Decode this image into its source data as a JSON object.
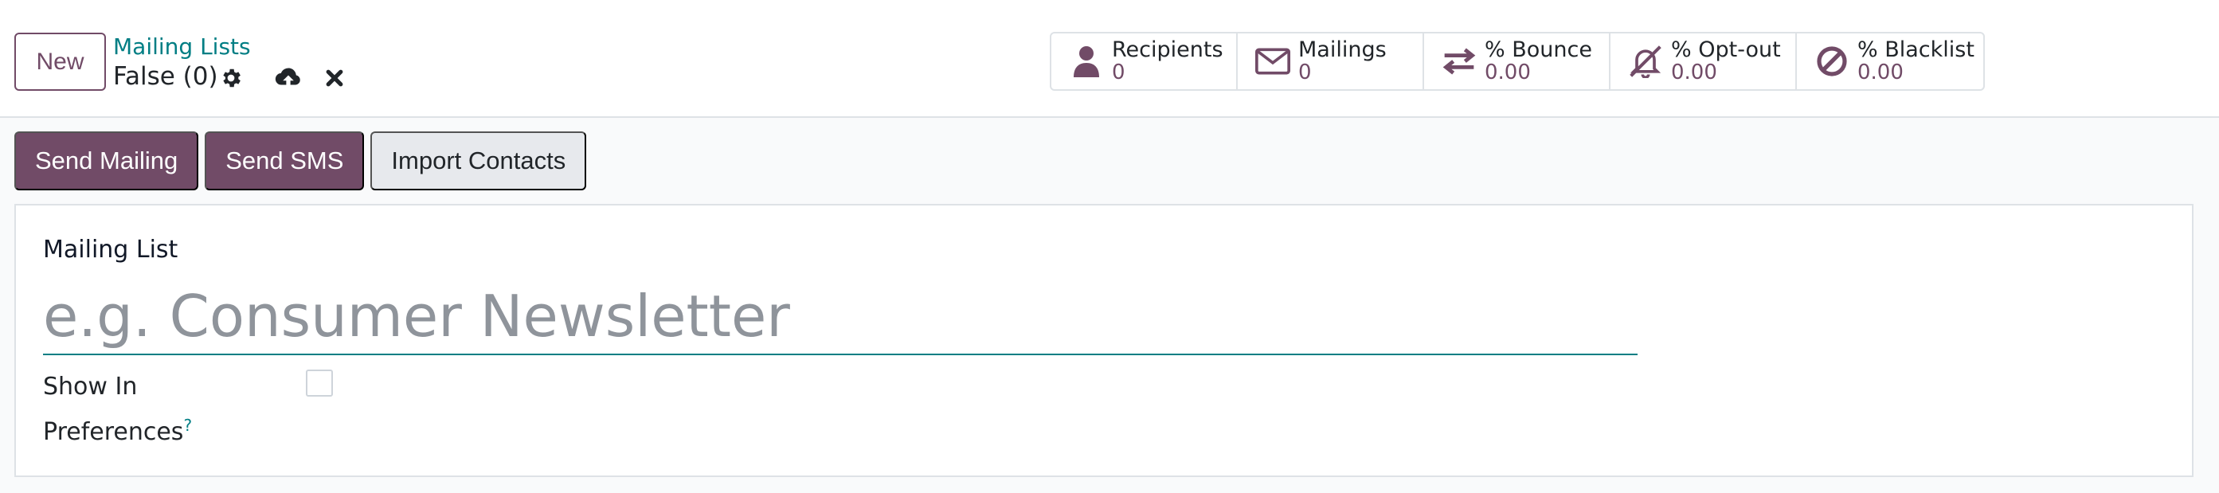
{
  "header": {
    "new_button": "New",
    "breadcrumb": "Mailing Lists",
    "record_title": "False (0)",
    "icons": [
      "gear-icon",
      "cloud-upload-icon",
      "close-icon"
    ]
  },
  "stats": [
    {
      "icon": "user-icon",
      "label": "Recipients",
      "value": "0"
    },
    {
      "icon": "envelope-icon",
      "label": "Mailings",
      "value": "0"
    },
    {
      "icon": "exchange-icon",
      "label": "% Bounce",
      "value": "0.00"
    },
    {
      "icon": "bell-slash-icon",
      "label": "% Opt-out",
      "value": "0.00"
    },
    {
      "icon": "ban-icon",
      "label": "% Blacklist",
      "value": "0.00"
    }
  ],
  "actions": {
    "send_mailing": "Send Mailing",
    "send_sms": "Send SMS",
    "import_contacts": "Import Contacts"
  },
  "form": {
    "name_label": "Mailing List",
    "name_placeholder": "e.g. Consumer Newsletter",
    "name_value": "",
    "pref_label": "Show In Preferences",
    "pref_help": "?",
    "pref_checked": false
  },
  "colors": {
    "brand": "#714b67",
    "link": "#017e84"
  }
}
